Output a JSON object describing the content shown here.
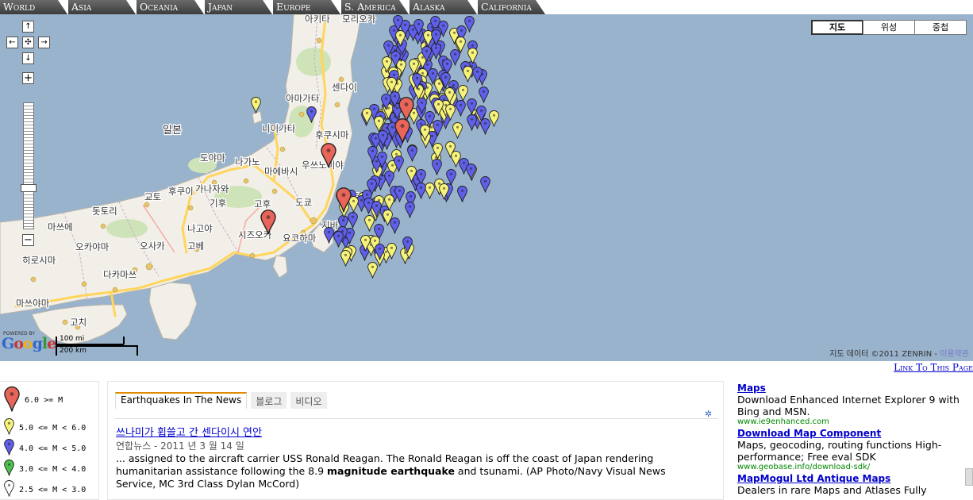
{
  "region_tabs": [
    "World",
    "Asia",
    "Oceania",
    "Japan",
    "Europe",
    "S. America",
    "Alaska",
    "California"
  ],
  "map": {
    "type_buttons": [
      {
        "label": "지도",
        "active": true
      },
      {
        "label": "위성",
        "active": false
      },
      {
        "label": "중첩",
        "active": false
      }
    ],
    "controls": {
      "pan_up": "↑",
      "pan_left": "←",
      "pan_center": "✣",
      "pan_right": "→",
      "pan_down": "↓",
      "zoom_in": "+",
      "zoom_out": "−"
    },
    "powered_by": "POWERED BY",
    "logo": "Google",
    "scale": {
      "mi": "100 mi",
      "km": "200 km"
    },
    "copyright": "지도 데이터 ©2011 ZENRIN - ",
    "terms": "이용약관",
    "place_labels": [
      "아키타",
      "모리오카",
      "아마가타",
      "센다이",
      "니이가타",
      "후쿠시마",
      "도야마",
      "나가노",
      "우쓰노미야",
      "마에바시",
      "후쿠이",
      "가나자와",
      "기후",
      "도쿄",
      "고후",
      "시즈오카",
      "요코하마",
      "교토",
      "오사카",
      "고베",
      "나고야",
      "히로시마",
      "오카야마",
      "다카마쓰",
      "마쓰야마",
      "고치",
      "돗토리",
      "마쓰에",
      "일본",
      "미토",
      "지바"
    ],
    "colors": {
      "water": "#99b3cc",
      "land": "#f2efe9",
      "road": "#ffd55a",
      "red": "#e9655a",
      "yellow": "#f7f37a",
      "blue": "#5f5fe9",
      "green": "#4ec04e",
      "white": "#ffffff"
    }
  },
  "link_to_page": "Link To This Page",
  "legend": [
    {
      "label": "6.0 >= M",
      "color": "red"
    },
    {
      "label": "5.0 <= M < 6.0",
      "color": "yellow"
    },
    {
      "label": "4.0 <= M < 5.0",
      "color": "blue"
    },
    {
      "label": "3.0 <= M < 4.0",
      "color": "green"
    },
    {
      "label": "2.5 <= M < 3.0",
      "color": "white"
    }
  ],
  "news": {
    "tabs": [
      {
        "label": "Earthquakes In The News",
        "active": true
      },
      {
        "label": "블로그",
        "active": false
      },
      {
        "label": "비디오",
        "active": false
      }
    ],
    "headline": "쓰나미가 휩쓸고 간 센다이시 연안",
    "source": "연합뉴스",
    "date": " - 2011 년 3 월 14 일",
    "body_start": "... assigned to the aircraft carrier USS Ronald Reagan. The Ronald Reagan is off the coast of Japan rendering humanitarian assistance following the 8.9 ",
    "body_bold": "magnitude earthquake",
    "body_end": " and tsunami. (AP Photo/Navy Visual News Service, MC 3rd Class Dylan McCord)"
  },
  "ads": [
    {
      "title": "Maps",
      "body": "Download Enhanced Internet Explorer 9 with Bing and MSN.",
      "url": "www.ie9enhanced.com"
    },
    {
      "title": "Download Map Component",
      "body": "Maps, geocoding, routing functions High-performance; Free eval SDK",
      "url": "www.geobase.info/download-sdk/"
    },
    {
      "title": "MapMogul Ltd Antique Maps",
      "body": "Dealers in rare Maps and Atlases Fully",
      "url": ""
    }
  ]
}
